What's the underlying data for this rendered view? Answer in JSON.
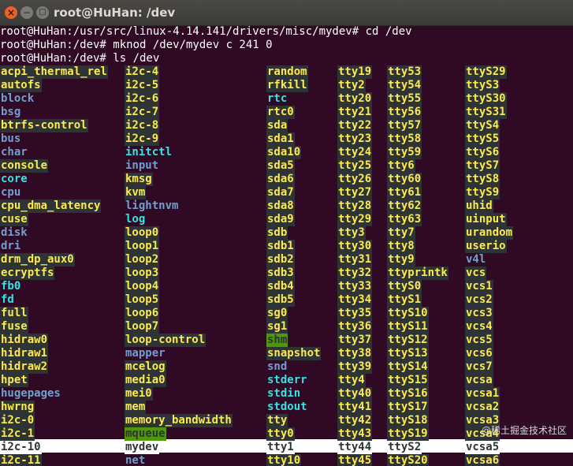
{
  "window": {
    "title": "root@HuHan: /dev",
    "close_glyph": "×",
    "min_glyph": "−",
    "max_glyph": "□"
  },
  "terminal": {
    "lines": [
      "root@HuHan:/usr/src/linux-4.14.141/drivers/misc/mydev# cd /dev",
      "root@HuHan:/dev# mknod /dev/mydev c 241 0",
      "root@HuHan:/dev# ls /dev"
    ],
    "highlighted_row": 28,
    "columns": [
      [
        "acpi_thermal_rel",
        "autofs",
        "block",
        "bsg",
        "btrfs-control",
        "bus",
        "char",
        "console",
        "core",
        "cpu",
        "cpu_dma_latency",
        "cuse",
        "disk",
        "dri",
        "drm_dp_aux0",
        "ecryptfs",
        "fb0",
        "fd",
        "full",
        "fuse",
        "hidraw0",
        "hidraw1",
        "hidraw2",
        "hpet",
        "hugepages",
        "hwrng",
        "i2c-0",
        "i2c-1",
        "i2c-10",
        "i2c-11"
      ],
      [
        "i2c-4",
        "i2c-5",
        "i2c-6",
        "i2c-7",
        "i2c-8",
        "i2c-9",
        "initctl",
        "input",
        "kmsg",
        "kvm",
        "lightnvm",
        "log",
        "loop0",
        "loop1",
        "loop2",
        "loop3",
        "loop4",
        "loop5",
        "loop6",
        "loop7",
        "loop-control",
        "mapper",
        "mcelog",
        "media0",
        "mei0",
        "mem",
        "memory_bandwidth",
        "mqueue",
        "mydev",
        "net"
      ],
      [
        "random",
        "rfkill",
        "rtc",
        "rtc0",
        "sda",
        "sda1",
        "sda10",
        "sda5",
        "sda6",
        "sda7",
        "sda8",
        "sda9",
        "sdb",
        "sdb1",
        "sdb2",
        "sdb3",
        "sdb4",
        "sdb5",
        "sg0",
        "sg1",
        "shm",
        "snapshot",
        "snd",
        "stderr",
        "stdin",
        "stdout",
        "tty",
        "tty0",
        "tty1",
        "tty10"
      ],
      [
        "tty19",
        "tty2",
        "tty20",
        "tty21",
        "tty22",
        "tty23",
        "tty24",
        "tty25",
        "tty26",
        "tty27",
        "tty28",
        "tty29",
        "tty3",
        "tty30",
        "tty31",
        "tty32",
        "tty33",
        "tty34",
        "tty35",
        "tty36",
        "tty37",
        "tty38",
        "tty39",
        "tty4",
        "tty40",
        "tty41",
        "tty42",
        "tty43",
        "tty44",
        "tty45"
      ],
      [
        "tty53",
        "tty54",
        "tty55",
        "tty56",
        "tty57",
        "tty58",
        "tty59",
        "tty6",
        "tty60",
        "tty61",
        "tty62",
        "tty63",
        "tty7",
        "tty8",
        "tty9",
        "ttyprintk",
        "ttyS0",
        "ttyS1",
        "ttyS10",
        "ttyS11",
        "ttyS12",
        "ttyS13",
        "ttyS14",
        "ttyS15",
        "ttyS16",
        "ttyS17",
        "ttyS18",
        "ttyS19",
        "ttyS2",
        "ttyS20"
      ],
      [
        "ttyS29",
        "ttyS3",
        "ttyS30",
        "ttyS31",
        "ttyS4",
        "ttyS5",
        "ttyS6",
        "ttyS7",
        "ttyS8",
        "ttyS9",
        "uhid",
        "uinput",
        "urandom",
        "userio",
        "v4l",
        "vcs",
        "vcs1",
        "vcs2",
        "vcs3",
        "vcs4",
        "vcs5",
        "vcs6",
        "vcs7",
        "vcsa",
        "vcsa1",
        "vcsa2",
        "vcsa3",
        "vcsa4",
        "vcsa5",
        "vcsa6"
      ]
    ],
    "kinds": [
      [
        "dev",
        "dev",
        "dir",
        "dir",
        "dev",
        "dir",
        "dir",
        "dev",
        "link",
        "dir",
        "dev",
        "dev",
        "dir",
        "dir",
        "dev",
        "dev",
        "link",
        "link",
        "dev",
        "dev",
        "dev",
        "dev",
        "dev",
        "dev",
        "dir",
        "dev",
        "dev",
        "dev",
        "dev",
        "dev"
      ],
      [
        "dev",
        "dev",
        "dev",
        "dev",
        "dev",
        "dev",
        "link",
        "dir",
        "dev",
        "dev",
        "dir",
        "link",
        "dev",
        "dev",
        "dev",
        "dev",
        "dev",
        "dev",
        "dev",
        "dev",
        "dev",
        "dir",
        "dev",
        "dev",
        "dev",
        "dev",
        "dev",
        "sticky",
        "dev",
        "dir"
      ],
      [
        "dev",
        "dev",
        "link",
        "dev",
        "dev",
        "dev",
        "dev",
        "dev",
        "dev",
        "dev",
        "dev",
        "dev",
        "dev",
        "dev",
        "dev",
        "dev",
        "dev",
        "dev",
        "dev",
        "dev",
        "sticky",
        "dev",
        "dir",
        "link",
        "link",
        "link",
        "dev",
        "dev",
        "dev",
        "dev"
      ],
      [
        "dev",
        "dev",
        "dev",
        "dev",
        "dev",
        "dev",
        "dev",
        "dev",
        "dev",
        "dev",
        "dev",
        "dev",
        "dev",
        "dev",
        "dev",
        "dev",
        "dev",
        "dev",
        "dev",
        "dev",
        "dev",
        "dev",
        "dev",
        "dev",
        "dev",
        "dev",
        "dev",
        "dev",
        "dev",
        "dev"
      ],
      [
        "dev",
        "dev",
        "dev",
        "dev",
        "dev",
        "dev",
        "dev",
        "dev",
        "dev",
        "dev",
        "dev",
        "dev",
        "dev",
        "dev",
        "dev",
        "dev",
        "dev",
        "dev",
        "dev",
        "dev",
        "dev",
        "dev",
        "dev",
        "dev",
        "dev",
        "dev",
        "dev",
        "dev",
        "dev",
        "dev"
      ],
      [
        "dev",
        "dev",
        "dev",
        "dev",
        "dev",
        "dev",
        "dev",
        "dev",
        "dev",
        "dev",
        "dev",
        "dev",
        "dev",
        "dev",
        "dir",
        "dev",
        "dev",
        "dev",
        "dev",
        "dev",
        "dev",
        "dev",
        "dev",
        "dev",
        "dev",
        "dev",
        "dev",
        "dev",
        "dev",
        "dev"
      ]
    ]
  },
  "watermark": "@稀土掘金技术社区",
  "colors": {
    "background": "#300a24",
    "device": "#fce94f",
    "directory": "#729fcf",
    "symlink": "#34e2e2",
    "sticky_bg": "#4e9a06"
  }
}
